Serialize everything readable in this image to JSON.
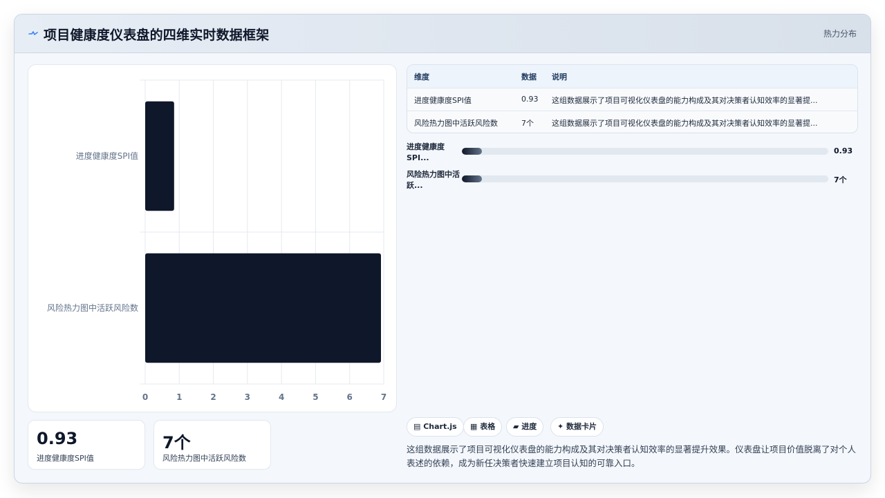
{
  "header": {
    "title": "项目健康度仪表盘的四维实时数据框架",
    "tag": "热力分布"
  },
  "chart_data": {
    "type": "bar",
    "orientation": "horizontal",
    "categories": [
      "进度健康度SPI值",
      "风险热力图中活跃风险数"
    ],
    "values": [
      0.93,
      7
    ],
    "xlim": [
      0,
      7
    ],
    "xticks": [
      "0",
      "1",
      "2",
      "3",
      "4",
      "5",
      "6",
      "7"
    ],
    "grid": true,
    "bar_color": "#0f172a"
  },
  "stats": [
    {
      "value": "0.93",
      "label": "进度健康度SPI值"
    },
    {
      "value": "7个",
      "label": "风险热力图中活跃风险数"
    }
  ],
  "table": {
    "headers": [
      "维度",
      "数据",
      "说明"
    ],
    "rows": [
      [
        "进度健康度SPI值",
        "0.93",
        "这组数据展示了项目可视化仪表盘的能力构成及其对决策者认知效率的显著提..."
      ],
      [
        "风险热力图中活跃风险数",
        "7个",
        "这组数据展示了项目可视化仪表盘的能力构成及其对决策者认知效率的显著提..."
      ]
    ]
  },
  "progress": [
    {
      "label": "进度健康度SPI...",
      "value_text": "0.93",
      "fraction": 0.055
    },
    {
      "label": "风险热力图中活跃...",
      "value_text": "7个",
      "fraction": 0.055
    }
  ],
  "chips": [
    "▤ Chart.js",
    "▦ 表格",
    "▰ 进度",
    "✦ 数据卡片"
  ],
  "description": "这组数据展示了项目可视化仪表盘的能力构成及其对决策者认知效率的显著提升效果。仪表盘让项目价值脱离了对个人表述的依赖，成为新任决策者快速建立项目认知的可靠入口。"
}
